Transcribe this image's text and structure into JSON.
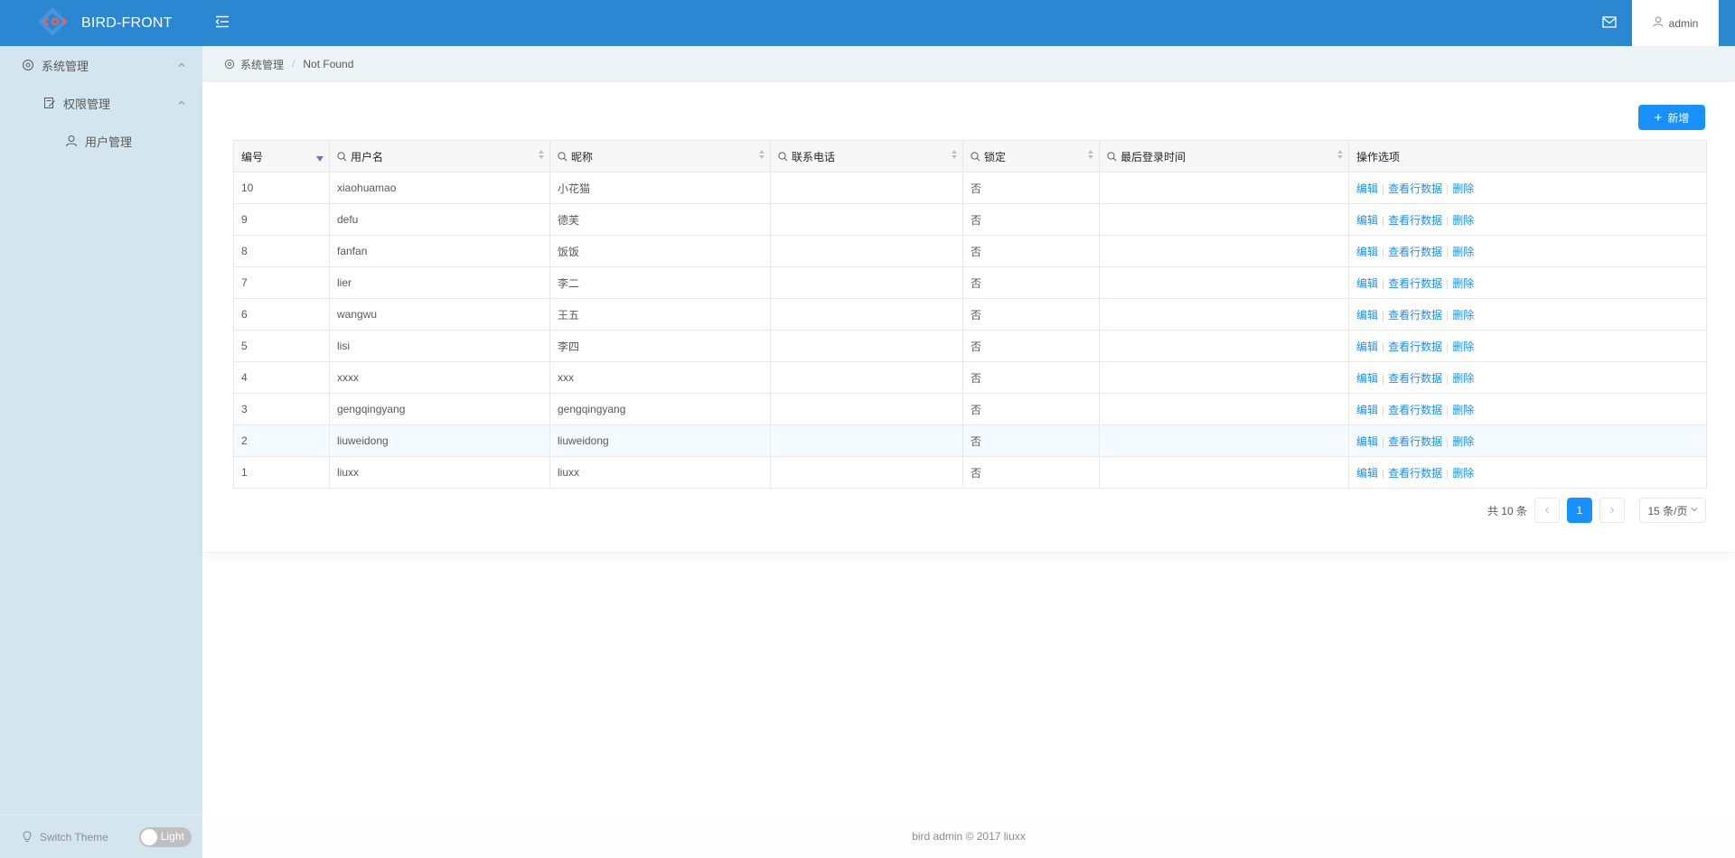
{
  "app": {
    "title": "BIRD-FRONT"
  },
  "header": {
    "user_name": "admin"
  },
  "sidebar": {
    "items": [
      {
        "label": "系统管理"
      },
      {
        "label": "权限管理"
      },
      {
        "label": "用户管理"
      }
    ],
    "switch_theme_label": "Switch Theme",
    "theme_toggle_label": "Light"
  },
  "breadcrumb": {
    "root": "系统管理",
    "current": "Not Found"
  },
  "toolbar": {
    "add_label": "新增"
  },
  "table": {
    "columns": [
      "编号",
      "用户名",
      "昵称",
      "联系电话",
      "锁定",
      "最后登录时间",
      "操作选项"
    ],
    "rows": [
      {
        "id": "10",
        "username": "xiaohuamao",
        "nickname": "小花猫",
        "phone": "",
        "locked": "否",
        "last_login": ""
      },
      {
        "id": "9",
        "username": "defu",
        "nickname": "德芙",
        "phone": "",
        "locked": "否",
        "last_login": ""
      },
      {
        "id": "8",
        "username": "fanfan",
        "nickname": "饭饭",
        "phone": "",
        "locked": "否",
        "last_login": ""
      },
      {
        "id": "7",
        "username": "lier",
        "nickname": "李二",
        "phone": "",
        "locked": "否",
        "last_login": ""
      },
      {
        "id": "6",
        "username": "wangwu",
        "nickname": "王五",
        "phone": "",
        "locked": "否",
        "last_login": ""
      },
      {
        "id": "5",
        "username": "lisi",
        "nickname": "李四",
        "phone": "",
        "locked": "否",
        "last_login": ""
      },
      {
        "id": "4",
        "username": "xxxx",
        "nickname": "xxx",
        "phone": "",
        "locked": "否",
        "last_login": ""
      },
      {
        "id": "3",
        "username": "gengqingyang",
        "nickname": "gengqingyang",
        "phone": "",
        "locked": "否",
        "last_login": ""
      },
      {
        "id": "2",
        "username": "liuweidong",
        "nickname": "liuweidong",
        "phone": "",
        "locked": "否",
        "last_login": ""
      },
      {
        "id": "1",
        "username": "liuxx",
        "nickname": "liuxx",
        "phone": "",
        "locked": "否",
        "last_login": ""
      }
    ],
    "actions": {
      "edit": "编辑",
      "view": "查看行数据",
      "delete": "删除"
    },
    "highlighted_row": "2"
  },
  "pagination": {
    "total_text": "共 10 条",
    "current_page": "1",
    "page_size": "15 条/页"
  },
  "footer": {
    "text": "bird admin © 2017 liuxx"
  },
  "colors": {
    "header": "#2b87d1",
    "sidebar": "#d3e6f0",
    "accent": "#1890ff"
  }
}
